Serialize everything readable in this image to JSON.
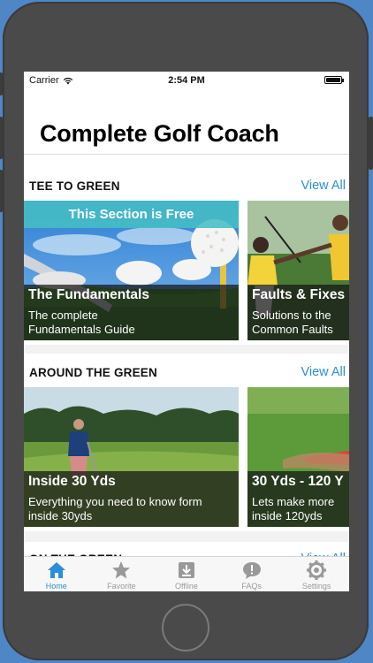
{
  "status": {
    "carrier": "Carrier",
    "time": "2:54 PM"
  },
  "nav": {
    "title": "Complete Golf Coach"
  },
  "sections": [
    {
      "title": "TEE TO GREEN",
      "view_all": "View All",
      "cards": [
        {
          "badge": "This Section is Free",
          "title": "The Fundamentals",
          "sub1": "The complete",
          "sub2": "Fundamentals Guide"
        },
        {
          "title": "Faults & Fixes",
          "sub1": "Solutions to the",
          "sub2": "Common Faults"
        }
      ]
    },
    {
      "title": "AROUND THE GREEN",
      "view_all": "View All",
      "cards": [
        {
          "title": "Inside 30 Yds",
          "sub1": "Everything you need to know form",
          "sub2": "inside 30yds"
        },
        {
          "title": "30 Yds - 120 Y",
          "sub1": "Lets make more",
          "sub2": "inside 120yds"
        }
      ]
    },
    {
      "title": "ON THE GREEN",
      "view_all": "View All"
    }
  ],
  "tabs": [
    {
      "label": "Home",
      "icon": "home-icon",
      "active": true
    },
    {
      "label": "Favorite",
      "icon": "star-icon",
      "active": false
    },
    {
      "label": "Offline",
      "icon": "download-icon",
      "active": false
    },
    {
      "label": "FAQs",
      "icon": "chat-icon",
      "active": false
    },
    {
      "label": "Settings",
      "icon": "gear-icon",
      "active": false
    }
  ],
  "colors": {
    "accent": "#2a8fd8",
    "free_band": "#46bec3",
    "background": "#4f86c6"
  }
}
